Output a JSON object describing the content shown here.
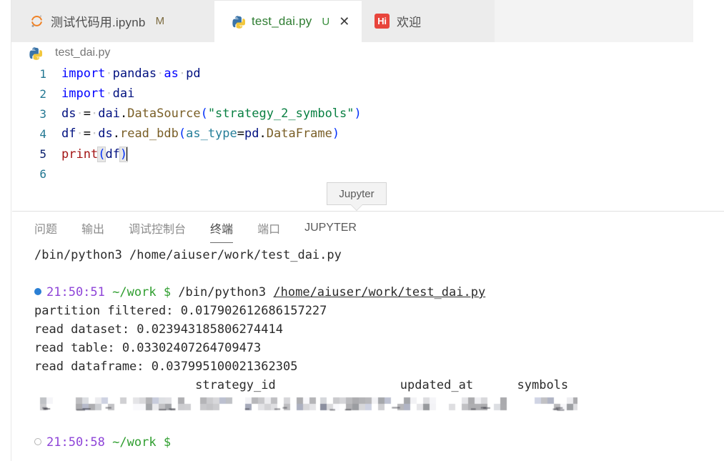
{
  "window": {
    "app": "vscode-light"
  },
  "editor_tabs": [
    {
      "icon": "jupyter-notebook-icon",
      "label": "测试代码用.ipynb",
      "badge": "M",
      "active": false,
      "closable": false
    },
    {
      "icon": "python-file-icon",
      "label": "test_dai.py",
      "badge": "U",
      "close": "✕",
      "active": true,
      "closable": true
    },
    {
      "icon": "welcome-hi-icon",
      "icon_text": "Hi",
      "label": "欢迎",
      "badge": "",
      "active": false,
      "closable": false
    }
  ],
  "breadcrumb": {
    "icon": "python-file-icon",
    "label": "test_dai.py"
  },
  "code": {
    "language": "python",
    "lines": [
      {
        "n": "1",
        "text": "import pandas as pd"
      },
      {
        "n": "2",
        "text": "import dai"
      },
      {
        "n": "3",
        "text": "ds = dai.DataSource(\"strategy_2_symbols\")"
      },
      {
        "n": "4",
        "text": "df = ds.read_bdb(as_type=pd.DataFrame)"
      },
      {
        "n": "5",
        "text": "print(df)"
      },
      {
        "n": "6",
        "text": ""
      }
    ],
    "cursor_line": "5"
  },
  "tooltip": {
    "text": "Jupyter"
  },
  "panel": {
    "tabs": [
      {
        "label": "问题",
        "active": false
      },
      {
        "label": "输出",
        "active": false
      },
      {
        "label": "调试控制台",
        "active": false
      },
      {
        "label": "终端",
        "active": true
      },
      {
        "label": "端口",
        "active": false
      },
      {
        "label": "JUPYTER",
        "active": false,
        "strong": true
      }
    ]
  },
  "terminal": {
    "run_command": "/bin/python3 /home/aiuser/work/test_dai.py",
    "prompt1": {
      "bullet": "filled",
      "time": "21:50:51",
      "cwd": "~/work",
      "symbol": "$",
      "command": "/bin/python3",
      "link": "/home/aiuser/work/test_dai.py"
    },
    "output": [
      "partition filtered: 0.017902612686157227",
      "read dataset: 0.023943185806274414",
      "read table: 0.03302407264709473",
      "read dataframe: 0.037995100021362305"
    ],
    "dataframe_header": {
      "columns": [
        "strategy_id",
        "updated_at",
        "symbols"
      ],
      "row_line": "                      strategy_id                 updated_at      symbols"
    },
    "dataframe_row_redacted": true,
    "prompt2": {
      "bullet": "hollow",
      "time": "21:50:58",
      "cwd": "~/work",
      "symbol": "$"
    }
  },
  "colors": {
    "tab_active_text": "#2f7d32",
    "tab_inactive_bg": "#ececec",
    "tabbar_bg": "#f3f3f3",
    "terminal_time": "#8e44d8",
    "terminal_cwd": "#2f9e2f",
    "bullet_active": "#2a7fd4",
    "welcome_icon_bg": "#e8453c",
    "string_token": "#0a8043",
    "keyword_token": "#0000ff"
  }
}
